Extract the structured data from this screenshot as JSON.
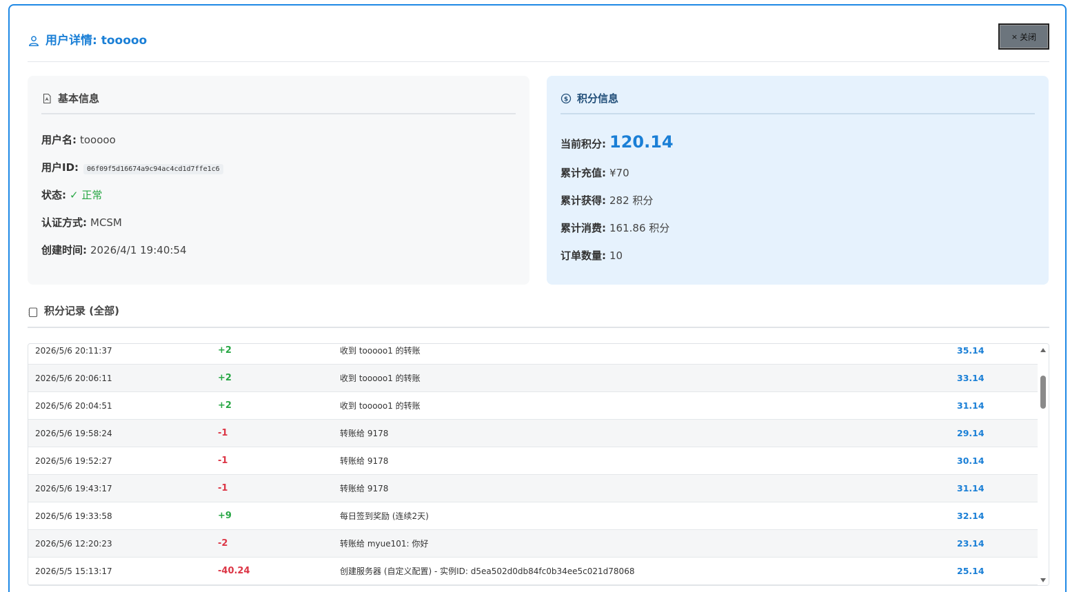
{
  "header": {
    "title": "用户详情: tooooo",
    "close_label": "关闭",
    "close_x": "×"
  },
  "basic": {
    "title": "基本信息",
    "username_label": "用户名:",
    "username": "tooooo",
    "userid_label": "用户ID:",
    "userid": "06f09f5d16674a9c94ac4cd1d7ffe1c6",
    "status_label": "状态:",
    "status": "✓ 正常",
    "auth_label": "认证方式:",
    "auth": "MCSM",
    "created_label": "创建时间:",
    "created": "2026/4/1 19:40:54"
  },
  "points": {
    "title": "积分信息",
    "current_label": "当前积分:",
    "current": "120.14",
    "recharge_label": "累计充值:",
    "recharge": "¥70",
    "earned_label": "累计获得:",
    "earned": "282 积分",
    "spent_label": "累计消费:",
    "spent": "161.86 积分",
    "orders_label": "订单数量:",
    "orders": "10"
  },
  "records": {
    "title": "积分记录 (全部)",
    "rows": [
      {
        "time": "2026/5/6 20:11:37",
        "change": "+2",
        "desc": "收到 tooooo1 的转账",
        "balance": "35.14"
      },
      {
        "time": "2026/5/6 20:06:11",
        "change": "+2",
        "desc": "收到 tooooo1 的转账",
        "balance": "33.14"
      },
      {
        "time": "2026/5/6 20:04:51",
        "change": "+2",
        "desc": "收到 tooooo1 的转账",
        "balance": "31.14"
      },
      {
        "time": "2026/5/6 19:58:24",
        "change": "-1",
        "desc": "转账给 9178",
        "balance": "29.14"
      },
      {
        "time": "2026/5/6 19:52:27",
        "change": "-1",
        "desc": "转账给 9178",
        "balance": "30.14"
      },
      {
        "time": "2026/5/6 19:43:17",
        "change": "-1",
        "desc": "转账给 9178",
        "balance": "31.14"
      },
      {
        "time": "2026/5/6 19:33:58",
        "change": "+9",
        "desc": "每日签到奖励 (连续2天)",
        "balance": "32.14"
      },
      {
        "time": "2026/5/6 12:20:23",
        "change": "-2",
        "desc": "转账给 myue101: 你好",
        "balance": "23.14"
      },
      {
        "time": "2026/5/5 15:13:17",
        "change": "-40.24",
        "desc": "创建服务器 (自定义配置) - 实例ID: d5ea502d0db84fc0b34ee5c021d78068",
        "balance": "25.14"
      }
    ]
  },
  "colors": {
    "accent": "#1a7fd6",
    "positive": "#28a745",
    "negative": "#dc3545"
  },
  "icons": {
    "title": "user-icon",
    "basic": "file-icon",
    "points": "coin-icon",
    "records": "clipboard-icon"
  }
}
